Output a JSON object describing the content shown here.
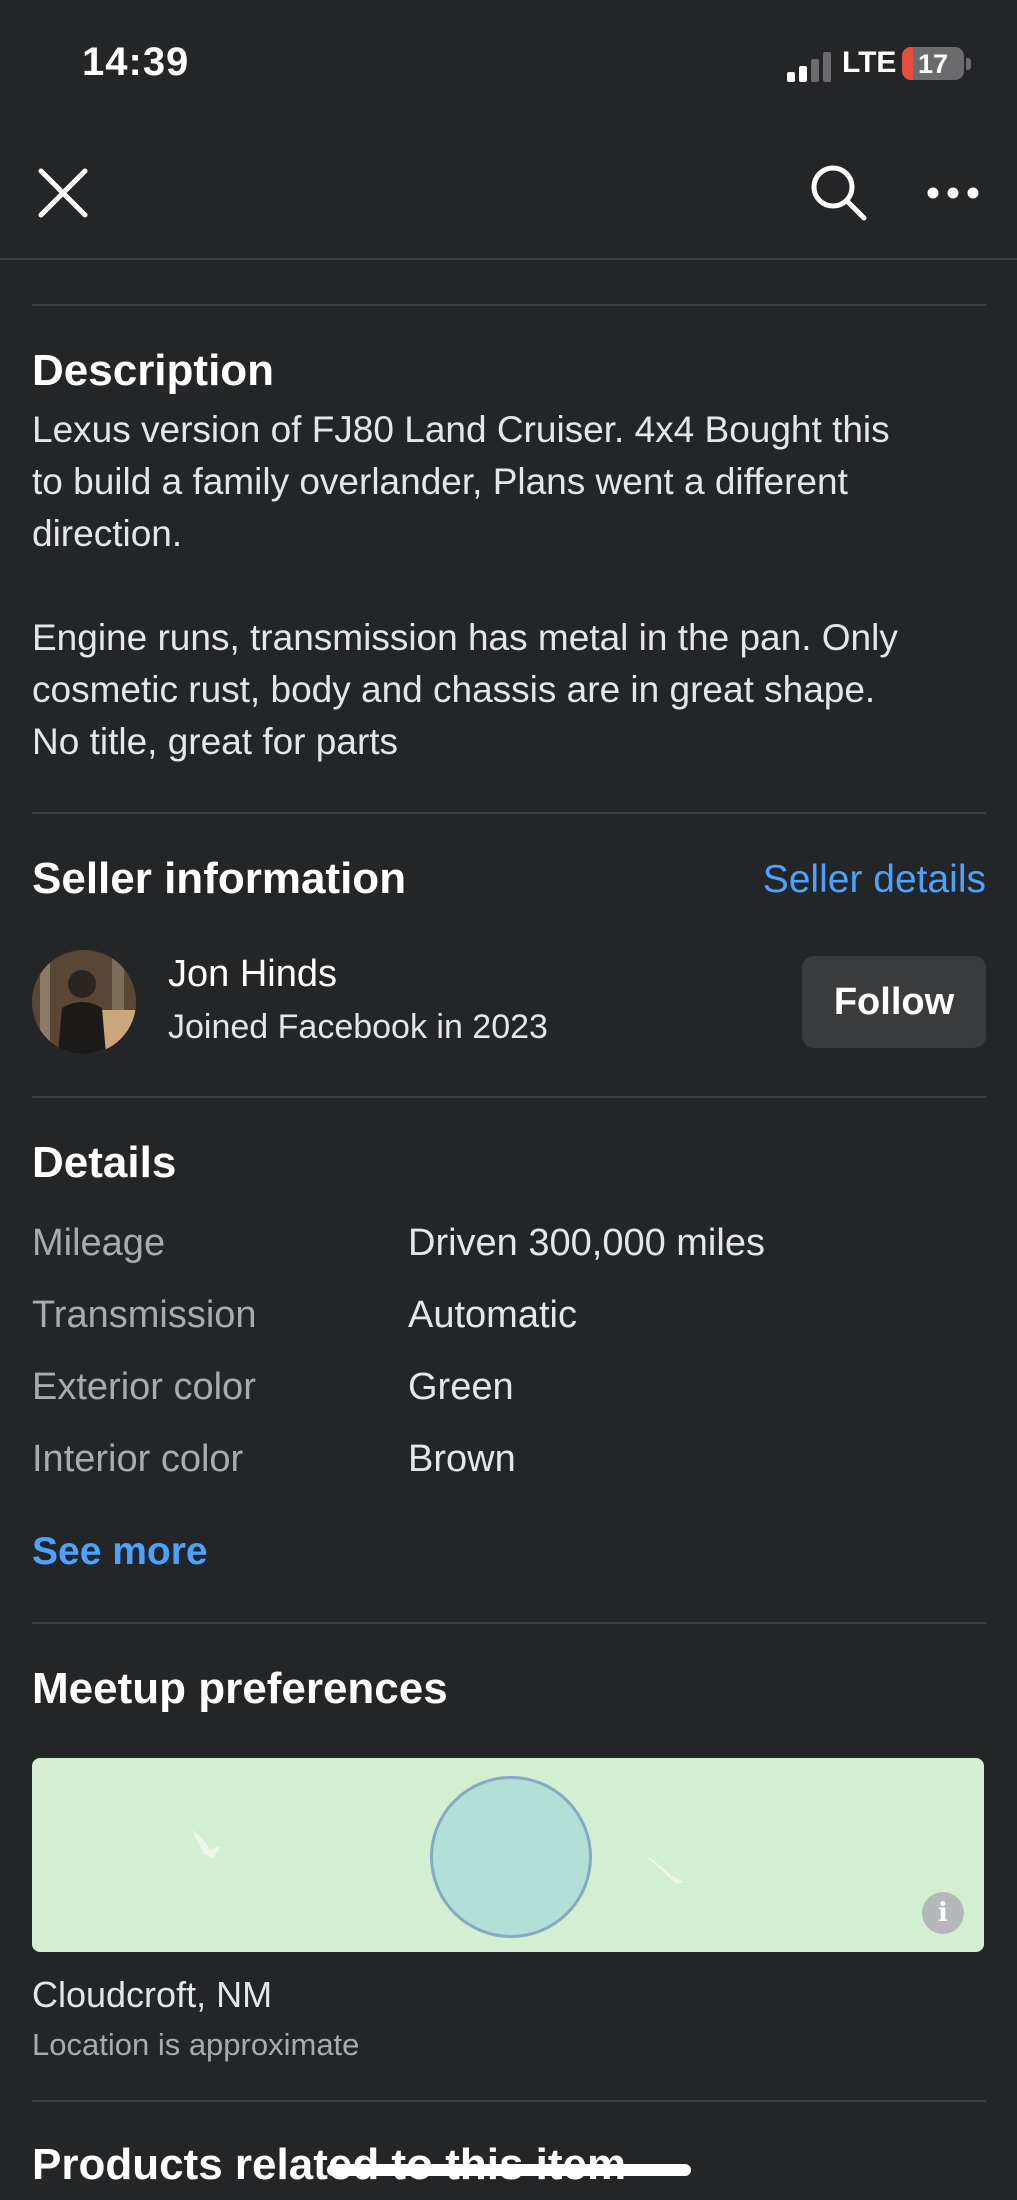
{
  "status_bar": {
    "time": "14:39",
    "network": "LTE",
    "battery": "17",
    "battery_level": 0.17
  },
  "nav": {
    "close_icon": "close-icon",
    "search_icon": "search-icon",
    "more_icon": "more-icon"
  },
  "description": {
    "title": "Description",
    "paragraph_1": "Lexus version of FJ80 Land Cruiser. 4x4 Bought this\nto build a family overlander, Plans went a different\ndirection.",
    "paragraph_2": "Engine runs, transmission has metal in the pan. Only\ncosmetic rust, body and chassis are in great shape.\nNo title, great for parts"
  },
  "seller": {
    "title": "Seller information",
    "details_link": "Seller details",
    "name": "Jon Hinds",
    "joined": "Joined Facebook in 2023",
    "follow_label": "Follow"
  },
  "details": {
    "title": "Details",
    "rows": [
      {
        "label": "Mileage",
        "value": "Driven 300,000 miles"
      },
      {
        "label": "Transmission",
        "value": "Automatic"
      },
      {
        "label": "Exterior color",
        "value": "Green"
      },
      {
        "label": "Interior color",
        "value": "Brown"
      }
    ],
    "see_more": "See more"
  },
  "meetup": {
    "title": "Meetup preferences",
    "info_glyph": "i",
    "city": "Cloudcroft, NM",
    "note": "Location is approximate"
  },
  "related": {
    "title": "Products related to this item"
  },
  "colors": {
    "background": "#242527",
    "link": "#4ba3ff",
    "button": "#3a3b3c",
    "map": "#d3efd1"
  }
}
